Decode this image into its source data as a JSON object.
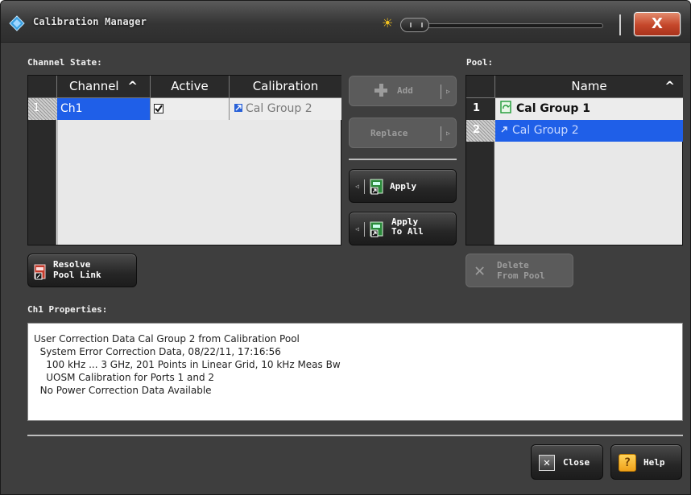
{
  "window": {
    "title": "Calibration Manager"
  },
  "labels": {
    "channel_state": "Channel State:",
    "pool": "Pool:",
    "properties": "Ch1 Properties:"
  },
  "channel_table": {
    "columns": [
      "Channel",
      "Active",
      "Calibration"
    ],
    "sort_indicator": "^",
    "rows": [
      {
        "num": "1",
        "channel": "Ch1",
        "active_checked": true,
        "calibration": "Cal Group 2"
      }
    ]
  },
  "pool_table": {
    "columns": [
      "Name"
    ],
    "sort_indicator": "^",
    "rows": [
      {
        "num": "1",
        "name": "Cal Group 1"
      },
      {
        "num": "2",
        "name": "Cal Group 2"
      }
    ]
  },
  "buttons": {
    "add": "Add",
    "replace": "Replace",
    "apply": "Apply",
    "apply_to_all_line1": "Apply",
    "apply_to_all_line2": "To All",
    "resolve_line1": "Resolve",
    "resolve_line2": "Pool Link",
    "delete_line1": "Delete",
    "delete_line2": "From Pool",
    "close": "Close",
    "help": "Help",
    "window_close": "X"
  },
  "properties": {
    "lines": [
      "User Correction Data Cal Group 2 from Calibration Pool",
      "  System Error Correction Data, 08/22/11, 17:16:56",
      "    100 kHz ... 3 GHz, 201 Points in Linear Grid, 10 kHz Meas Bw",
      "    UOSM Calibration for Ports 1 and 2",
      "  No Power Correction Data Available"
    ]
  },
  "colors": {
    "selection": "#1f5fe8",
    "window_bg": "#3e3e3e",
    "grid_bg": "#e8e8e8"
  },
  "icons": {
    "app": "rs-diamond-icon",
    "brightness": "sun-icon",
    "cal_group_bold": "green-cal-icon",
    "cal_group_link": "link-arrow-icon"
  }
}
